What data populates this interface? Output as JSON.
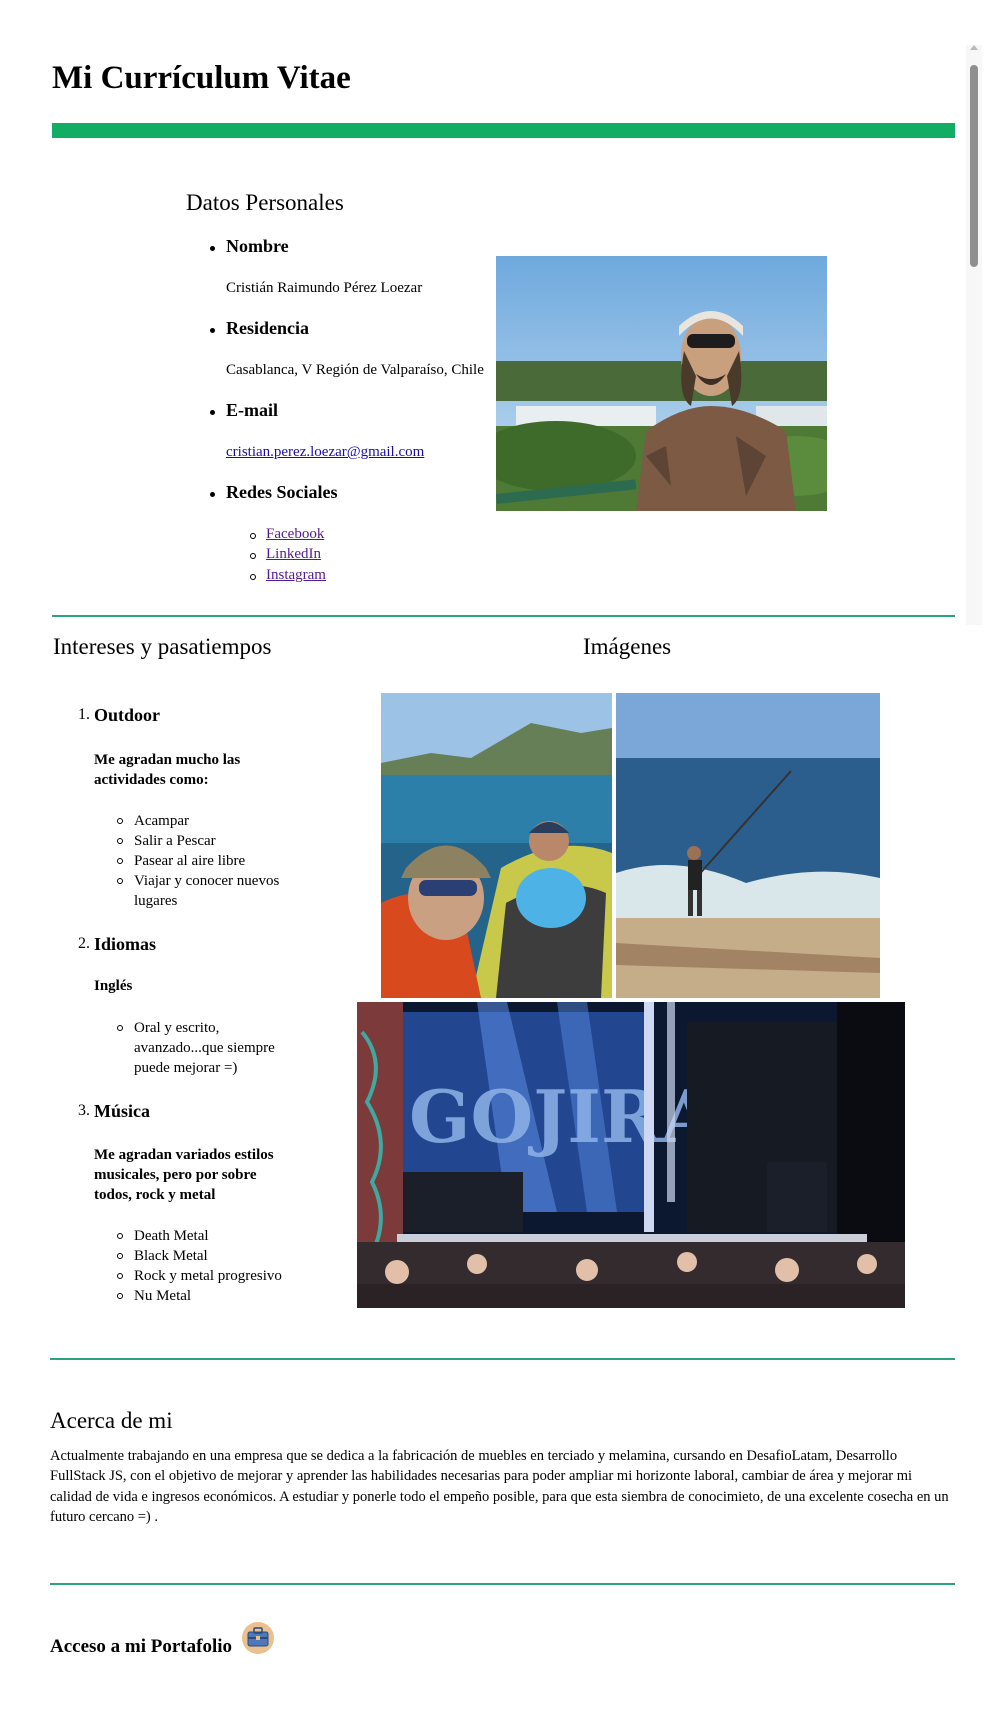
{
  "header": {
    "title": "Mi Currículum Vitae"
  },
  "personal": {
    "heading": "Datos Personales",
    "items": [
      {
        "label": "Nombre",
        "value": "Cristián Raimundo Pérez Loezar"
      },
      {
        "label": "Residencia",
        "value": "Casablanca, V Región de Valparaíso, Chile"
      },
      {
        "label": "E-mail",
        "value": "cristian.perez.loezar@gmail.com"
      },
      {
        "label": "Redes Sociales",
        "links": [
          "Facebook",
          "LinkedIn",
          "Instagram"
        ]
      }
    ]
  },
  "interests": {
    "heading": "Intereses y pasatiempos",
    "items": [
      {
        "number": "1.",
        "title": "Outdoor",
        "subtitle": "Me agradan mucho las actividades como:",
        "list": [
          "Acampar",
          "Salir a Pescar",
          "Pasear al aire libre",
          "Viajar y conocer nuevos lugares"
        ]
      },
      {
        "number": "2.",
        "title": "Idiomas",
        "subtitle": "Inglés",
        "list": [
          "Oral y escrito, avanzado...que siempre puede mejorar =)"
        ]
      },
      {
        "number": "3.",
        "title": "Música",
        "subtitle": "Me agradan variados estilos musicales, pero por sobre todos, rock y metal",
        "list": [
          "Death Metal",
          "Black Metal",
          "Rock y metal progresivo",
          "Nu Metal"
        ]
      }
    ]
  },
  "images": {
    "heading": "Imágenes",
    "concert_banner_text": "GOJIRA"
  },
  "about": {
    "heading": "Acerca de mi",
    "text": "Actualmente trabajando en una empresa que se dedica a la fabricación de muebles en terciado y melamina, cursando en DesafioLatam, Desarrollo FullStack JS, con el objetivo de mejorar y aprender las habilidades necesarias para poder ampliar mi horizonte laboral, cambiar de área y mejorar mi calidad de vida e ingresos económicos. A estudiar y ponerle todo el empeño posible, para que esta siembra de conocimieto, de una excelente cosecha en un futuro cercano =) ."
  },
  "portfolio": {
    "label": "Acceso a mi Portafolio",
    "icon": "briefcase-icon"
  },
  "colors": {
    "accent": "#12ad64",
    "divider": "#2aa57a",
    "link": "#1a0dab",
    "visited": "#551a8b"
  }
}
